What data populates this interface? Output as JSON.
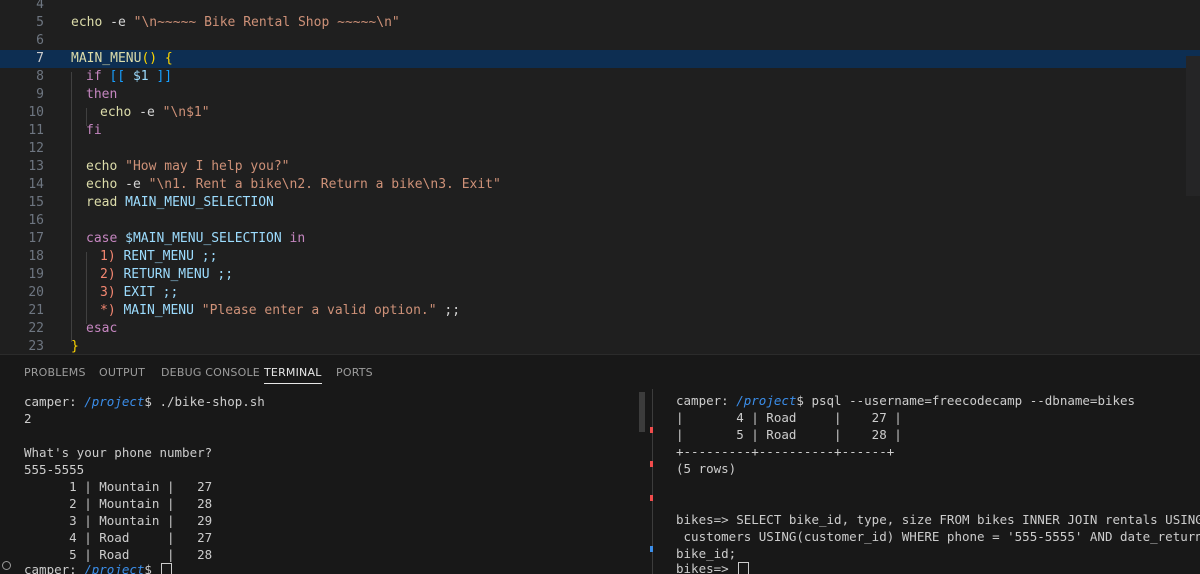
{
  "editor": {
    "lines": [
      {
        "n": "4"
      },
      {
        "n": "5"
      },
      {
        "n": "6"
      },
      {
        "n": "7"
      },
      {
        "n": "8"
      },
      {
        "n": "9"
      },
      {
        "n": "10"
      },
      {
        "n": "11"
      },
      {
        "n": "12"
      },
      {
        "n": "13"
      },
      {
        "n": "14"
      },
      {
        "n": "15"
      },
      {
        "n": "16"
      },
      {
        "n": "17"
      },
      {
        "n": "18"
      },
      {
        "n": "19"
      },
      {
        "n": "20"
      },
      {
        "n": "21"
      },
      {
        "n": "22"
      },
      {
        "n": "23"
      }
    ],
    "code": {
      "l5_echo": "echo",
      "l5_flag": " -e ",
      "l5_str": "\"\\n~~~~~ Bike Rental Shop ~~~~~\\n\"",
      "l7_fn": "MAIN_MENU",
      "l7_paren": "()",
      "l7_brace": " {",
      "l8_if": "if",
      "l8_open": " [[",
      "l8_var": " $1",
      "l8_close": " ]]",
      "l9_then": "then",
      "l10_echo": "echo",
      "l10_flag": " -e ",
      "l10_str": "\"\\n$1\"",
      "l11_fi": "fi",
      "l13_echo": "echo",
      "l13_str": " \"How may I help you?\"",
      "l14_echo": "echo",
      "l14_flag": " -e ",
      "l14_str": "\"\\n1. Rent a bike\\n2. Return a bike\\n3. Exit\"",
      "l15_read": "read",
      "l15_var": " MAIN_MENU_SELECTION",
      "l17_case": "case",
      "l17_var": " $MAIN_MENU_SELECTION",
      "l17_in": " in",
      "l18_pat": "1)",
      "l18_cmd": " RENT_MENU ;;",
      "l19_pat": "2)",
      "l19_cmd": " RETURN_MENU ;;",
      "l20_pat": "3)",
      "l20_cmd": " EXIT ;;",
      "l21_pat": "*)",
      "l21_cmd": " MAIN_MENU",
      "l21_str": " \"Please enter a valid option.\"",
      "l21_end": " ;;",
      "l22_esac": "esac",
      "l23_brace": "}"
    }
  },
  "panel": {
    "tabs": [
      "PROBLEMS",
      "OUTPUT",
      "DEBUG CONSOLE",
      "TERMINAL",
      "PORTS"
    ],
    "active_tab": "TERMINAL"
  },
  "terminal_left": {
    "prompt_user": "camper:",
    "prompt_path": " /project",
    "cmd1": "$ ./bike-shop.sh",
    "l2": "2",
    "l3": "",
    "l4": "What's your phone number?",
    "l5": "555-5555",
    "rows": [
      "      1 | Mountain |   27",
      "      2 | Mountain |   28",
      "      3 | Mountain |   29",
      "      4 | Road     |   27",
      "      5 | Road     |   28"
    ],
    "last_prompt_user": "camper:",
    "last_prompt_path": " /project",
    "last_prompt_end": "$ "
  },
  "terminal_right": {
    "prompt_user": "camper:",
    "prompt_path": " /project",
    "cmd": "$ psql --username=freecodecamp --dbname=bikes",
    "lines": [
      "|       4 | Road     |    27 |",
      "|       5 | Road     |    28 |",
      "+---------+----------+------+",
      "(5 rows)",
      "",
      "",
      "",
      "bikes=> SELECT bike_id, type, size FROM bikes INNER JOIN rentals USING(bike_i",
      " customers USING(customer_id) WHERE phone = '555-5555' AND date_returned IS N",
      "bike_id;",
      "bikes=> "
    ]
  },
  "colors": {
    "accent": "#3b8eea",
    "active_line": "#0d2e52"
  }
}
